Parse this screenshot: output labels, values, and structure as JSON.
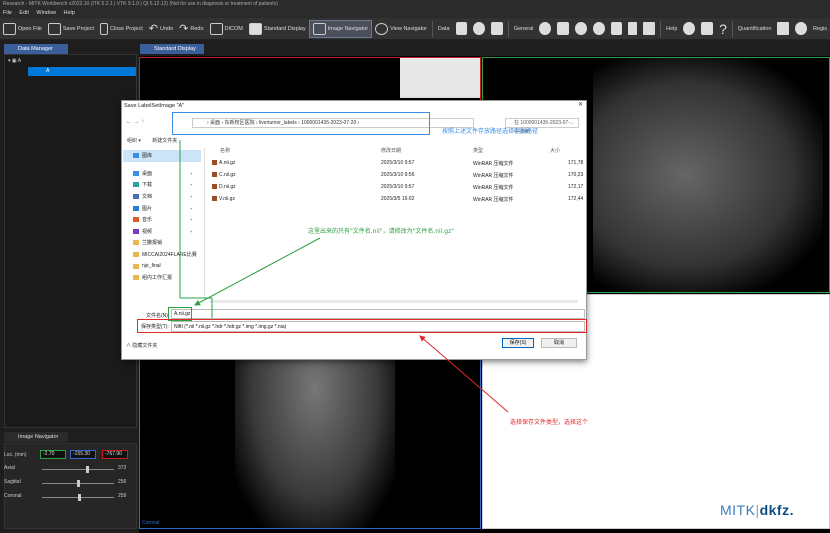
{
  "window": {
    "title": "Research - MITK Workbench v2022.10 (ITK 5.2.1 | VTK 9.1.0 | Qt 5.12.12) (Not for use in diagnosis or treatment of patients)"
  },
  "menu": [
    "File",
    "Edit",
    "Window",
    "Help"
  ],
  "toolbar": {
    "open_file": "Open File",
    "save_project": "Save Project",
    "close_project": "Close Project",
    "undo": "Undo",
    "redo": "Redo",
    "dicom": "DICOM",
    "standard_display": "Standard Display",
    "image_navigator": "Image Navigator",
    "view_navigator": "View Navigator",
    "data": "Data",
    "general": "General",
    "help": "Help",
    "quantification": "Quantification",
    "registration": "Regis"
  },
  "data_manager": {
    "tab_label": "Data Manager",
    "root_item": "A",
    "child_item": "A"
  },
  "image_navigator": {
    "tab_label": "Image Navigator",
    "loc_label": "Loc. (mm)",
    "loc_x": "-2.70",
    "loc_y": "-155.30",
    "loc_z": "-767.90",
    "axial_label": "Axial",
    "axial_value": "373",
    "sagittal_label": "Sagittal",
    "sagittal_value": "256",
    "coronal_label": "Coronal",
    "coronal_value": "259"
  },
  "display": {
    "tab_label": "Standard Display",
    "coronal_label": "Coronal",
    "logo_left": "MITK",
    "logo_right": "dkfz."
  },
  "dialog": {
    "title": "Save LabelSetImage \"A\"",
    "close": "✕",
    "breadcrumb": "› 桌面 › 东新校区医院 › livertumor_labels › 1000001435-2023-07-20 ›",
    "search_placeholder": "在 1000001435-2023-07-... 中搜索",
    "organize": "组织 ▾",
    "new_folder": "新建文件夹",
    "sidebar": [
      "图库",
      "桌面",
      "下载",
      "文档",
      "图片",
      "音乐",
      "视频",
      "兰撒报销",
      "MICCAI2024FLARE比赛",
      "nje_final",
      "组内工作汇报"
    ],
    "columns": {
      "name": "名称",
      "date": "修改日期",
      "type": "类型",
      "size": "大小"
    },
    "files": [
      {
        "name": "A.nii.gz",
        "date": "2025/3/10 9:57",
        "type": "WinRAR 压缩文件",
        "size": "171,78"
      },
      {
        "name": "C.nii.gz",
        "date": "2025/3/10 9:56",
        "type": "WinRAR 压缩文件",
        "size": "170,23"
      },
      {
        "name": "D.nii.gz",
        "date": "2025/3/10 9:57",
        "type": "WinRAR 压缩文件",
        "size": "172,17"
      },
      {
        "name": "V.nii.gz",
        "date": "2025/3/5 16:02",
        "type": "WinRAR 压缩文件",
        "size": "172,44"
      }
    ],
    "filename_label": "文件名(N):",
    "filename_value": "A.nii.gz",
    "filetype_label": "保存类型(T):",
    "filetype_value": "NiftI (*.nii *.nii.gz *.hdr *.hdr.gz *.img *.img.gz *.nia)",
    "hide_folders": "∧ 隐藏文件夹",
    "save_button": "保存(S)",
    "cancel_button": "取消"
  },
  "annotations": {
    "path_note": "按照上述文件存放路径选择存放路径",
    "name_note": "这里出来的只有\"文件名.nii\"，请修改为\"文件名.nii.gz\"",
    "type_note": "选择保存文件类型，选择这个"
  },
  "colors": {
    "accent_blue": "#3a8ee6",
    "annotation_green": "#2ea043",
    "annotation_red": "#e02828",
    "selection": "#0078d7"
  }
}
